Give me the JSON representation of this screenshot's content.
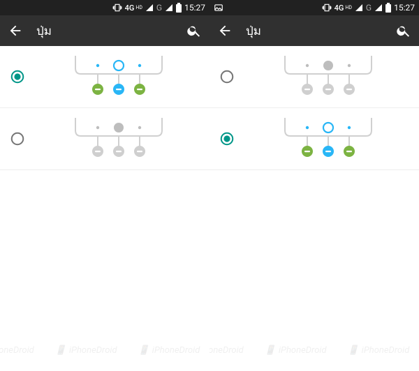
{
  "status": {
    "network_label": "4G",
    "hd_superscript": "HD",
    "g_label": "G",
    "time": "15:27",
    "time_right": "15:27",
    "has_screenshot_icon_right_pane": true
  },
  "appbar": {
    "title": "ปุ่ม"
  },
  "options": {
    "colored": "colored-nav-buttons",
    "gray": "gray-nav-buttons"
  },
  "left_pane": {
    "selected_index": 0
  },
  "right_pane": {
    "selected_index": 1
  },
  "colors": {
    "accent": "#009688",
    "green": "#7cb342",
    "blue": "#29b6f6",
    "gray": "#bdbdbd",
    "outline": "#d0d0d0"
  },
  "watermark": {
    "text": "iPhoneDroid"
  }
}
